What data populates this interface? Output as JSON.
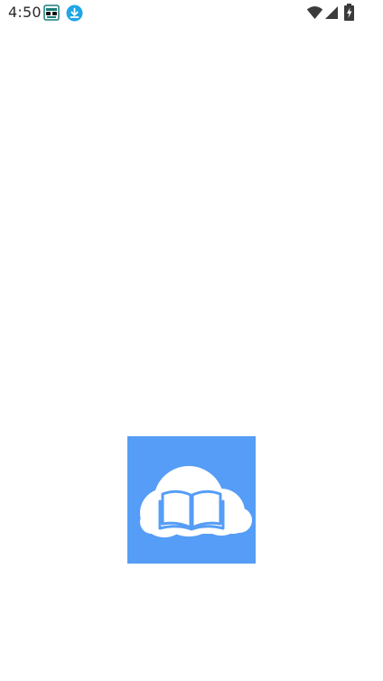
{
  "status_bar": {
    "time": "4:50",
    "notification_icons": [
      "game-controller-icon",
      "download-icon"
    ],
    "system_icons": [
      "wifi-icon",
      "signal-icon",
      "battery-charging-icon"
    ]
  },
  "splash": {
    "logo_icon": "cloud-book-icon",
    "colors": {
      "background": "#ffffff",
      "logo_background": "#559df6",
      "logo_foreground": "#ffffff"
    }
  }
}
